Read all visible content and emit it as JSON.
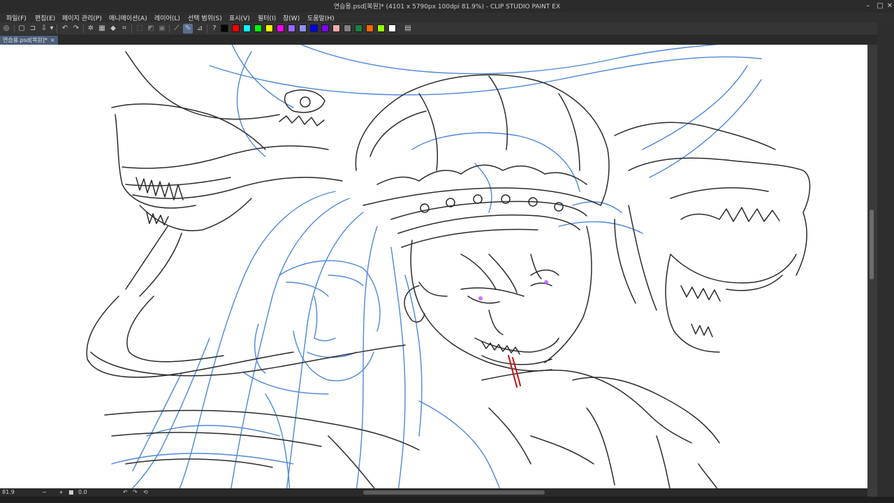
{
  "window": {
    "title": "연습용.psd[복원]* (4101 x 5790px 100dpi 81.9%)  - CLIP STUDIO PAINT EX",
    "controls": [
      "–",
      "□",
      "✕"
    ]
  },
  "menu": [
    "파일(F)",
    "편집(E)",
    "페이지 관리(P)",
    "애니메이션(A)",
    "레이어(L)",
    "선택 범위(S)",
    "표시(V)",
    "필터(I)",
    "창(W)",
    "도움말(H)"
  ],
  "toolbar": {
    "icons": [
      "navigator-icon",
      "new-file-icon",
      "open-file-icon",
      "save-icon",
      "undo-icon",
      "redo-icon",
      "transform-icon",
      "fill-icon",
      "selection-icon",
      "pen-icon",
      "help-icon"
    ],
    "colors": [
      "#000000",
      "#ff0000",
      "#00ffff",
      "#00ff00",
      "#ffff00",
      "#ff00ff",
      "#9966ff",
      "#8f8fff",
      "#0000ff",
      "#8000ff",
      "#ffaaaa",
      "#808080",
      "#208040",
      "#ff6600",
      "#99ff00",
      "#ffffff"
    ]
  },
  "document_tab": {
    "label": "연습용.psd[복원]*",
    "close": "×"
  },
  "status": {
    "zoom": "81.9",
    "rotation": "0.0"
  }
}
